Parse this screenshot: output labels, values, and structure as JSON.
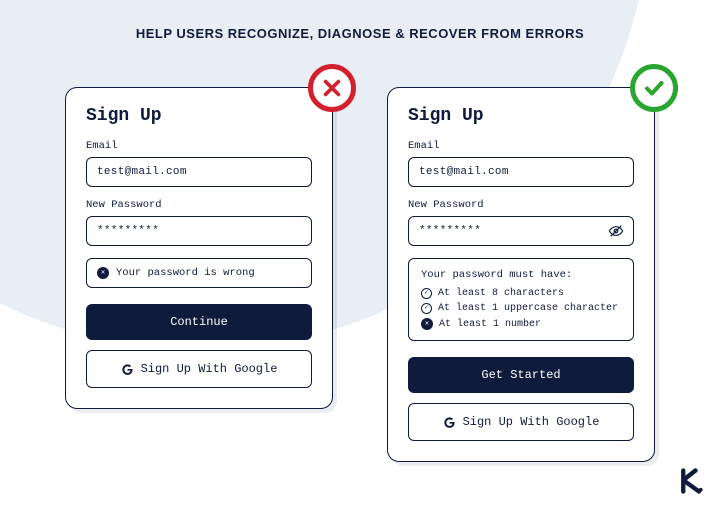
{
  "title": "HELP USERS RECOGNIZE, DIAGNOSE & RECOVER FROM ERRORS",
  "bad": {
    "heading": "Sign Up",
    "email_label": "Email",
    "email_value": "test@mail.com",
    "password_label": "New Password",
    "password_value": "*********",
    "error_text": "Your password is wrong",
    "primary_btn": "Continue",
    "google_btn": "Sign Up With Google"
  },
  "good": {
    "heading": "Sign Up",
    "email_label": "Email",
    "email_value": "test@mail.com",
    "password_label": "New Password",
    "password_value": "*********",
    "hint_title": "Your password must have:",
    "hints": [
      {
        "text": "At least 8 characters",
        "ok": true
      },
      {
        "text": "At least 1 uppercase character",
        "ok": true
      },
      {
        "text": "At least 1 number",
        "ok": false
      }
    ],
    "primary_btn": "Get Started",
    "google_btn": "Sign Up With Google"
  }
}
